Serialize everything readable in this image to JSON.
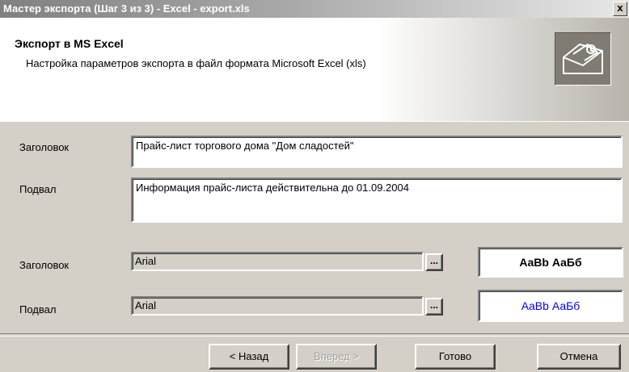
{
  "window": {
    "title": "Мастер экспорта (Шаг 3 из 3) - Excel - export.xls",
    "close_label": "x"
  },
  "header": {
    "title": "Экспорт в MS Excel",
    "description": "Настройка параметров экспорта в файл формата Microsoft Excel (xls)",
    "icon": "envelope-export-icon"
  },
  "text_fields": {
    "header_label": "Заголовок",
    "header_value": "Прайс-лист торгового дома \"Дом сладостей\"",
    "footer_label": "Подвал",
    "footer_value": "Информация прайс-листа действительна до 01.09.2004"
  },
  "font_fields": {
    "header_label": "Заголовок",
    "header_font": "Arial",
    "footer_label": "Подвал",
    "footer_font": "Arial",
    "ellipsis": "...",
    "header_preview": "AaBb АаБб",
    "footer_preview": "AaBb АаБб",
    "header_preview_color": "#000000",
    "footer_preview_color": "#0000ff"
  },
  "buttons": {
    "back": "< Назад",
    "next": "Вперед >",
    "finish": "Готово",
    "cancel": "Отмена"
  }
}
